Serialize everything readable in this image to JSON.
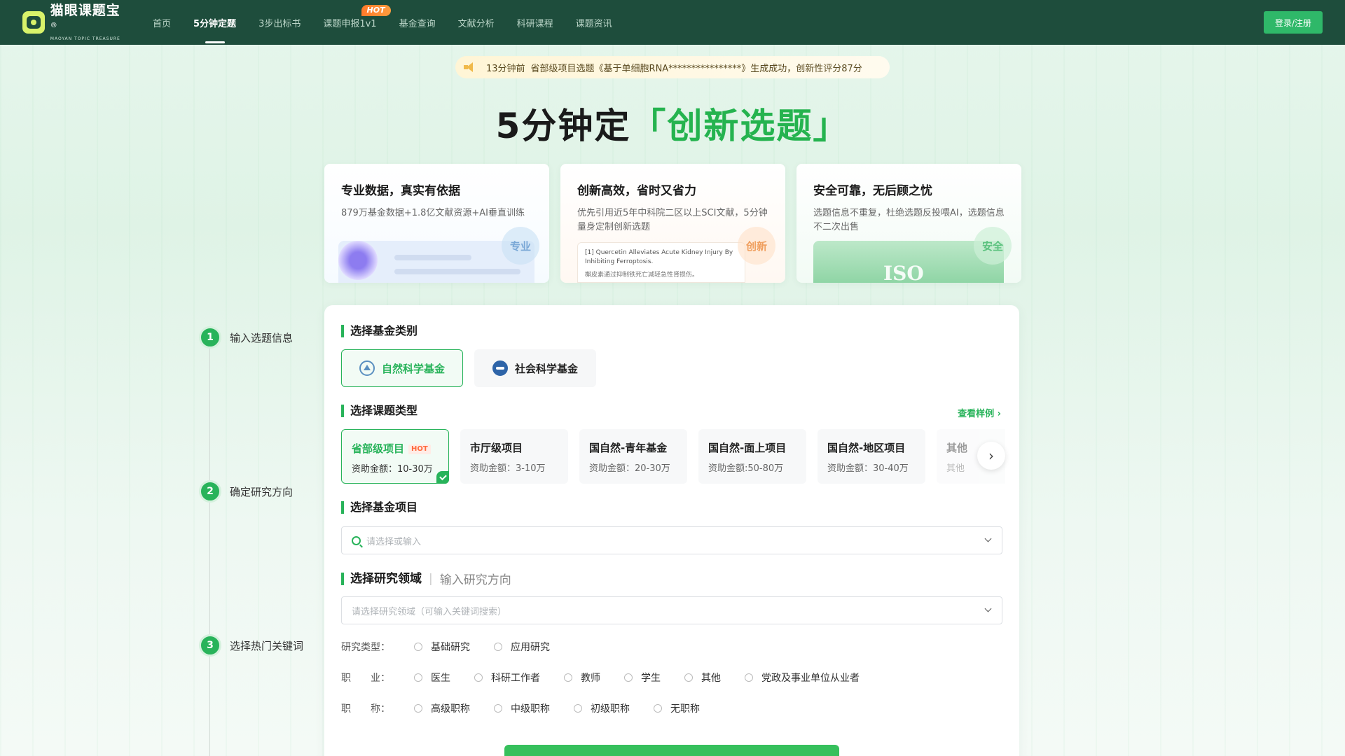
{
  "header": {
    "logo_main": "猫眼课题宝",
    "logo_reg": "®",
    "logo_sub": "MAOYAN TOPIC TREASURE",
    "nav": [
      {
        "label": "首页"
      },
      {
        "label": "5分钟定题"
      },
      {
        "label": "3步出标书"
      },
      {
        "label": "课题申报1v1",
        "badge": "HOT"
      },
      {
        "label": "基金查询"
      },
      {
        "label": "文献分析"
      },
      {
        "label": "科研课程"
      },
      {
        "label": "课题资讯"
      }
    ],
    "login": "登录/注册"
  },
  "notice": {
    "time": "13分钟前",
    "text": "省部级项目选题《基于单细胞RNA****************》生成成功，创新性评分87分"
  },
  "hero": {
    "title_prefix": "5分钟定",
    "title_highlight": "「创新选题」"
  },
  "features": [
    {
      "title": "专业数据，真实有依据",
      "desc": "879万基金数据+1.8亿文献资源+AI垂直训练",
      "tag": "专业"
    },
    {
      "title": "创新高效，省时又省力",
      "desc": "优先引用近5年中科院二区以上SCI文献，5分钟量身定制创新选题",
      "tag": "创新",
      "paper_title": "[1] Quercetin Alleviates Acute Kidney Injury By Inhibiting Ferroptosis.",
      "paper_cn": "槲皮素通过抑制铁死亡减轻急性肾损伤。"
    },
    {
      "title": "安全可靠，无后顾之忧",
      "desc": "选题信息不重复，杜绝选题反投喂AI，选题信息不二次出售",
      "tag": "安全",
      "badge_text": "ISO"
    }
  ],
  "steps": [
    {
      "num": "1",
      "label": "输入选题信息"
    },
    {
      "num": "2",
      "label": "确定研究方向"
    },
    {
      "num": "3",
      "label": "选择热门关键词"
    }
  ],
  "form": {
    "fund_category_title": "选择基金类别",
    "fund_categories": [
      {
        "label": "自然科学基金"
      },
      {
        "label": "社会科学基金"
      }
    ],
    "project_type_title": "选择课题类型",
    "see_sample": "查看样例",
    "project_types": [
      {
        "name": "省部级项目",
        "badge": "HOT",
        "amount": "资助金额：10-30万"
      },
      {
        "name": "市厅级项目",
        "amount": "资助金额：3-10万"
      },
      {
        "name": "国自然-青年基金",
        "amount": "资助金额：20-30万"
      },
      {
        "name": "国自然-面上项目",
        "amount": "资助金额:50-80万"
      },
      {
        "name": "国自然-地区项目",
        "amount": "资助金额：30-40万"
      },
      {
        "name": "其他",
        "amount": "其他"
      }
    ],
    "fund_project_title": "选择基金项目",
    "fund_project_placeholder": "请选择或输入",
    "field_tab_active": "选择研究领域",
    "field_tab_other": "输入研究方向",
    "field_placeholder": "请选择研究领域（可输入关键词搜索）",
    "research_type": {
      "label": "研究类型：",
      "options": [
        "基础研究",
        "应用研究"
      ]
    },
    "occupation": {
      "label": "职　　业：",
      "options": [
        "医生",
        "科研工作者",
        "教师",
        "学生",
        "其他",
        "党政及事业单位从业者"
      ]
    },
    "title_rank": {
      "label": "职　　称：",
      "options": [
        "高级职称",
        "中级职称",
        "初级职称",
        "无职称"
      ]
    }
  }
}
